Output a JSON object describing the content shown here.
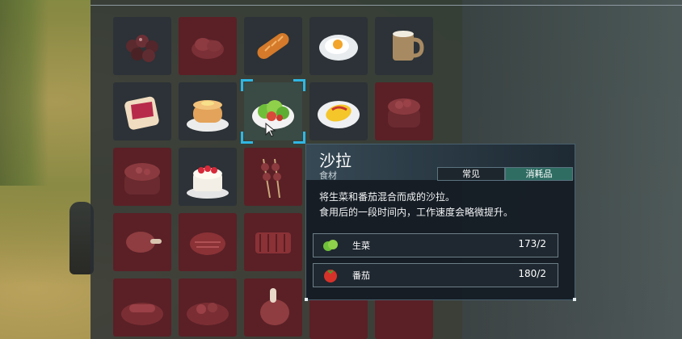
{
  "header": {
    "title": ""
  },
  "inventory": {
    "items": [
      {
        "name": "chestnuts",
        "red": false
      },
      {
        "name": "meat-dish",
        "red": true
      },
      {
        "name": "bread-loaf",
        "red": false
      },
      {
        "name": "fried-egg",
        "red": false
      },
      {
        "name": "milk-mug",
        "red": false
      },
      {
        "name": "jam-toast",
        "red": false
      },
      {
        "name": "pancakes",
        "red": false
      },
      {
        "name": "salad",
        "red": false,
        "selected": true
      },
      {
        "name": "omelette",
        "red": false
      },
      {
        "name": "stew-pot",
        "red": true
      },
      {
        "name": "soup-pot",
        "red": true
      },
      {
        "name": "cake",
        "red": false
      },
      {
        "name": "skewers",
        "red": true
      },
      {
        "name": "roast-leg",
        "red": true
      },
      {
        "name": "roast-steak",
        "red": true
      },
      {
        "name": "grilled-ribs",
        "red": true
      },
      {
        "name": "sausage-plate",
        "red": true
      },
      {
        "name": "veg-stew-plate",
        "red": true
      },
      {
        "name": "ham-leg",
        "red": true
      }
    ]
  },
  "tooltip": {
    "name": "沙拉",
    "category": "食材",
    "tag_common": "常见",
    "tag_consumable": "消耗品",
    "desc_line1": "将生菜和番茄混合而成的沙拉。",
    "desc_line2": "食用后的一段时间内，工作速度会略微提升。",
    "ingredients": [
      {
        "name": "生菜",
        "qty": "173/2",
        "icon": "lettuce-icon"
      },
      {
        "name": "番茄",
        "qty": "180/2",
        "icon": "tomato-icon"
      }
    ]
  },
  "colors": {
    "accent": "#2fb7e3",
    "consumable_tag": "#2f6d63",
    "slot_red": "#5a2026"
  }
}
